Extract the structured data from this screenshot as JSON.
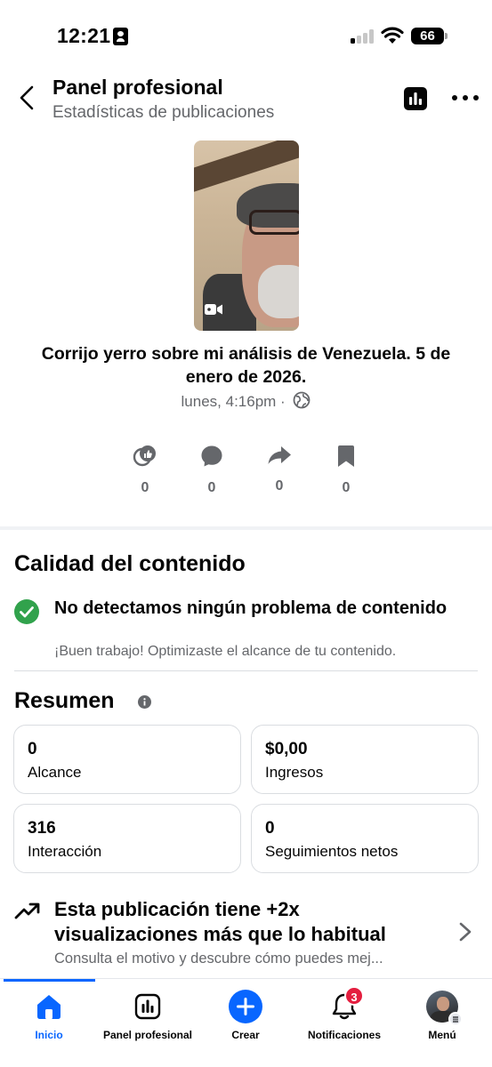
{
  "status_bar": {
    "time": "12:21",
    "battery": "66"
  },
  "header": {
    "title": "Panel profesional",
    "subtitle": "Estadísticas de publicaciones"
  },
  "post": {
    "title": "Corrijo yerro sobre mi análisis de Venezuela. 5 de enero de 2026.",
    "meta": "lunes, 4:16pm ·",
    "media_type": "video-icon"
  },
  "engagement": [
    {
      "icon": "reactions-icon",
      "count": "0"
    },
    {
      "icon": "comment-icon",
      "count": "0"
    },
    {
      "icon": "share-icon",
      "count": "0"
    },
    {
      "icon": "bookmark-icon",
      "count": "0"
    }
  ],
  "quality": {
    "title": "Calidad del contenido",
    "main": "No detectamos ningún problema de contenido",
    "sub": "¡Buen trabajo! Optimizaste el alcance de tu contenido."
  },
  "summary": {
    "title": "Resumen",
    "cards": [
      {
        "value": "0",
        "label": "Alcance"
      },
      {
        "value": "$0,00",
        "label": "Ingresos"
      },
      {
        "value": "316",
        "label": "Interacción"
      },
      {
        "value": "0",
        "label": "Seguimientos netos"
      }
    ]
  },
  "insight": {
    "main": "Esta publicación tiene +2x visualizaciones más que lo habitual",
    "sub": "Consulta el motivo y descubre cómo puedes mej..."
  },
  "tabbar": {
    "items": [
      {
        "label": "Inicio",
        "icon": "home-icon"
      },
      {
        "label": "Panel profesional",
        "icon": "dashboard-icon"
      },
      {
        "label": "Crear",
        "icon": "plus-icon"
      },
      {
        "label": "Notificaciones",
        "icon": "bell-icon",
        "badge": "3"
      },
      {
        "label": "Menú",
        "icon": "avatar"
      }
    ]
  },
  "colors": {
    "accent": "#0866ff",
    "success": "#31a24c",
    "badge": "#e41e3f",
    "secondary_text": "#65676b"
  }
}
